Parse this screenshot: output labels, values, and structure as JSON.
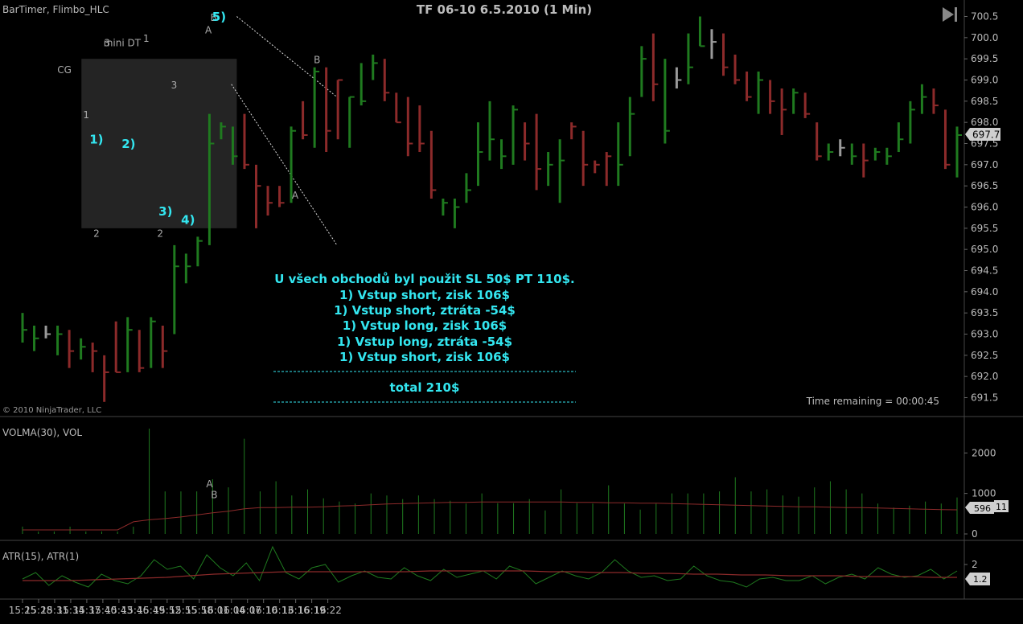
{
  "header": {
    "indicators": "BarTimer, Flimbo_HLC",
    "title": "TF 06-10 6.5.2010 (1 Min)",
    "copyright": "© 2010 NinjaTrader, LLC",
    "time_remaining": "Time remaining = 00:00:45"
  },
  "colors": {
    "up": "#1f7a1f",
    "down": "#8c2a2a",
    "neutral": "#9a9a9a",
    "annotation": "#33e6f0",
    "volume_line": "#8c2a2a",
    "atr_fast": "#1f7a1f",
    "atr_slow": "#8c2a2a"
  },
  "chart_data": [
    {
      "type": "ohlc",
      "name": "price",
      "x": [
        "15:25",
        "15:28",
        "15:31",
        "15:34",
        "15:37",
        "15:40",
        "15:43",
        "15:46",
        "15:49",
        "15:52",
        "15:55",
        "15:58",
        "16:01",
        "16:04",
        "16:07",
        "16:10",
        "16:13",
        "16:16",
        "16:19",
        "16:22"
      ],
      "ylim": [
        691.0,
        700.7
      ],
      "yticks": [
        "700.5",
        "700.0",
        "699.5",
        "699.0",
        "698.5",
        "698.0",
        "697.5",
        "697.0",
        "696.5",
        "696.0",
        "695.5",
        "695.0",
        "694.5",
        "694.0",
        "693.5",
        "693.0",
        "692.5",
        "692.0",
        "691.5"
      ],
      "last_price": "697.7",
      "bars": [
        [
          693.5,
          692.8,
          693.1,
          "up"
        ],
        [
          693.2,
          692.6,
          692.9,
          "up"
        ],
        [
          693.2,
          692.9,
          693.0,
          "neutral"
        ],
        [
          693.2,
          692.5,
          693.0,
          "up"
        ],
        [
          693.1,
          692.2,
          692.6,
          "down"
        ],
        [
          692.9,
          692.4,
          692.7,
          "up"
        ],
        [
          692.8,
          692.1,
          692.6,
          "down"
        ],
        [
          692.5,
          691.4,
          692.1,
          "down"
        ],
        [
          693.3,
          692.1,
          692.1,
          "down"
        ],
        [
          693.4,
          692.1,
          693.1,
          "up"
        ],
        [
          693.1,
          692.1,
          692.2,
          "down"
        ],
        [
          693.4,
          692.2,
          693.3,
          "up"
        ],
        [
          693.2,
          692.2,
          692.6,
          "down"
        ],
        [
          695.1,
          693.0,
          694.6,
          "up"
        ],
        [
          694.9,
          694.2,
          694.6,
          "up"
        ],
        [
          695.3,
          694.6,
          695.2,
          "up"
        ],
        [
          698.2,
          695.1,
          697.5,
          "up"
        ],
        [
          698.0,
          697.6,
          697.9,
          "up"
        ],
        [
          697.9,
          697.0,
          697.2,
          "up"
        ],
        [
          698.2,
          696.9,
          697.0,
          "down"
        ],
        [
          697.0,
          695.5,
          696.5,
          "down"
        ],
        [
          696.5,
          695.8,
          696.1,
          "down"
        ],
        [
          696.5,
          696.0,
          696.1,
          "down"
        ],
        [
          697.9,
          696.1,
          697.8,
          "up"
        ],
        [
          698.5,
          697.6,
          697.7,
          "down"
        ],
        [
          699.3,
          697.4,
          699.2,
          "up"
        ],
        [
          699.3,
          697.3,
          697.8,
          "down"
        ],
        [
          699.0,
          697.6,
          699.0,
          "down"
        ],
        [
          698.6,
          697.4,
          698.6,
          "up"
        ],
        [
          699.4,
          698.4,
          698.5,
          "up"
        ],
        [
          699.6,
          699.0,
          699.4,
          "up"
        ],
        [
          699.5,
          698.5,
          698.7,
          "down"
        ],
        [
          698.7,
          698.0,
          698.0,
          "down"
        ],
        [
          698.6,
          697.2,
          697.5,
          "down"
        ],
        [
          698.4,
          697.3,
          697.5,
          "down"
        ],
        [
          697.8,
          696.2,
          696.4,
          "down"
        ],
        [
          696.2,
          695.8,
          696.1,
          "up"
        ],
        [
          696.2,
          695.5,
          696.0,
          "up"
        ],
        [
          696.8,
          696.1,
          696.4,
          "up"
        ],
        [
          698.0,
          696.5,
          697.3,
          "up"
        ],
        [
          698.5,
          697.1,
          697.6,
          "up"
        ],
        [
          697.6,
          696.9,
          697.2,
          "up"
        ],
        [
          698.4,
          697.0,
          698.3,
          "up"
        ],
        [
          698.0,
          697.1,
          697.5,
          "down"
        ],
        [
          698.2,
          696.4,
          696.9,
          "down"
        ],
        [
          697.3,
          696.5,
          697.0,
          "up"
        ],
        [
          697.6,
          696.1,
          697.1,
          "up"
        ],
        [
          698.0,
          697.6,
          697.9,
          "down"
        ],
        [
          697.8,
          696.5,
          697.0,
          "down"
        ],
        [
          697.1,
          696.8,
          697.0,
          "down"
        ],
        [
          697.3,
          696.5,
          697.2,
          "down"
        ],
        [
          698.0,
          696.5,
          697.0,
          "up"
        ],
        [
          698.6,
          697.2,
          698.2,
          "up"
        ],
        [
          699.8,
          698.6,
          699.5,
          "up"
        ],
        [
          700.1,
          698.5,
          698.9,
          "down"
        ],
        [
          699.5,
          697.5,
          697.8,
          "up"
        ],
        [
          699.3,
          698.8,
          699.0,
          "neutral"
        ],
        [
          700.1,
          698.9,
          699.3,
          "up"
        ],
        [
          700.5,
          699.8,
          699.8,
          "up"
        ],
        [
          700.2,
          699.5,
          699.9,
          "neutral"
        ],
        [
          700.1,
          699.1,
          699.3,
          "down"
        ],
        [
          699.6,
          698.9,
          699.0,
          "down"
        ],
        [
          699.2,
          698.5,
          698.6,
          "down"
        ],
        [
          699.2,
          698.2,
          699.0,
          "up"
        ],
        [
          699.0,
          698.2,
          698.5,
          "down"
        ],
        [
          698.8,
          697.7,
          698.3,
          "down"
        ],
        [
          698.8,
          698.2,
          698.7,
          "up"
        ],
        [
          698.7,
          698.1,
          698.2,
          "down"
        ],
        [
          698.0,
          697.1,
          697.2,
          "down"
        ],
        [
          697.5,
          697.1,
          697.3,
          "up"
        ],
        [
          697.6,
          697.2,
          697.4,
          "neutral"
        ],
        [
          697.5,
          697.0,
          697.2,
          "up"
        ],
        [
          697.5,
          696.7,
          697.1,
          "down"
        ],
        [
          697.4,
          697.1,
          697.3,
          "up"
        ],
        [
          697.4,
          697.0,
          697.2,
          "up"
        ],
        [
          698.0,
          697.3,
          697.6,
          "up"
        ],
        [
          698.5,
          697.5,
          698.3,
          "up"
        ],
        [
          698.9,
          698.2,
          698.6,
          "up"
        ],
        [
          698.8,
          698.2,
          698.4,
          "down"
        ],
        [
          698.3,
          696.9,
          697.0,
          "down"
        ],
        [
          697.9,
          696.7,
          697.7,
          "up"
        ]
      ],
      "rectangle_label": "CG",
      "rectangle_range": [
        695.5,
        699.5
      ],
      "labels": [
        {
          "text": "3",
          "x": "15:40.8",
          "y": 699.8
        },
        {
          "text": "mini DT",
          "x": "15:43.6",
          "y": 699.8
        },
        {
          "text": "1",
          "x": "15:48.1",
          "y": 699.9
        },
        {
          "text": "1",
          "x": "15:36.9",
          "y": 698.1
        },
        {
          "text": "2",
          "x": "15:38.8",
          "y": 695.3
        },
        {
          "text": "2",
          "x": "15:50.7",
          "y": 695.3
        },
        {
          "text": "3",
          "x": "15:53.3",
          "y": 698.8
        },
        {
          "text": "A",
          "x": "15:59.7",
          "y": 700.1
        },
        {
          "text": "B",
          "x": "16:00.7",
          "y": 700.4
        },
        {
          "text": "B",
          "x": "16:20.0",
          "y": 699.4
        },
        {
          "text": "A",
          "x": "16:15.9",
          "y": 696.2
        }
      ],
      "annotations": [
        {
          "text": "1)",
          "x": "15:38.8",
          "y": 697.5
        },
        {
          "text": "2)",
          "x": "15:44.8",
          "y": 697.4
        },
        {
          "text": "3)",
          "x": "15:51.7",
          "y": 695.8
        },
        {
          "text": "4)",
          "x": "15:55.9",
          "y": 695.6
        },
        {
          "text": "5)",
          "x": "16:01.7",
          "y": 700.4
        }
      ],
      "lines": [
        {
          "from": [
            "16:05",
            "700.5"
          ],
          "to": [
            "16:23.7",
            "698.6"
          ]
        },
        {
          "from": [
            "16:04",
            "698.9"
          ],
          "to": [
            "16:23.7",
            "695.1"
          ]
        }
      ]
    },
    {
      "type": "bar",
      "name": "volume",
      "title": "VOLMA(30), VOL",
      "yticks": [
        "2000",
        "1000",
        "0"
      ],
      "ylim": [
        0,
        2700
      ],
      "last_ma": "596",
      "last_vol": "11",
      "labels": [
        {
          "text": "A",
          "x": "15:59.9",
          "y": 1150
        },
        {
          "text": "B",
          "x": "16:00.8",
          "y": 880
        }
      ]
    },
    {
      "type": "line",
      "name": "atr",
      "title": "ATR(15), ATR(1)",
      "yticks": [
        "2"
      ],
      "ylim": [
        0,
        3.3
      ],
      "last_value": "1.2"
    }
  ],
  "summary": {
    "lines": [
      "U všech obchodů byl použit SL 50$ PT 110$.",
      "1) Vstup short, zisk 106$",
      "1) Vstup short, ztráta -54$",
      "1) Vstup long, zisk 106$",
      "1) Vstup long, ztráta -54$",
      "1) Vstup short, zisk 106$"
    ],
    "total": "total 210$"
  }
}
